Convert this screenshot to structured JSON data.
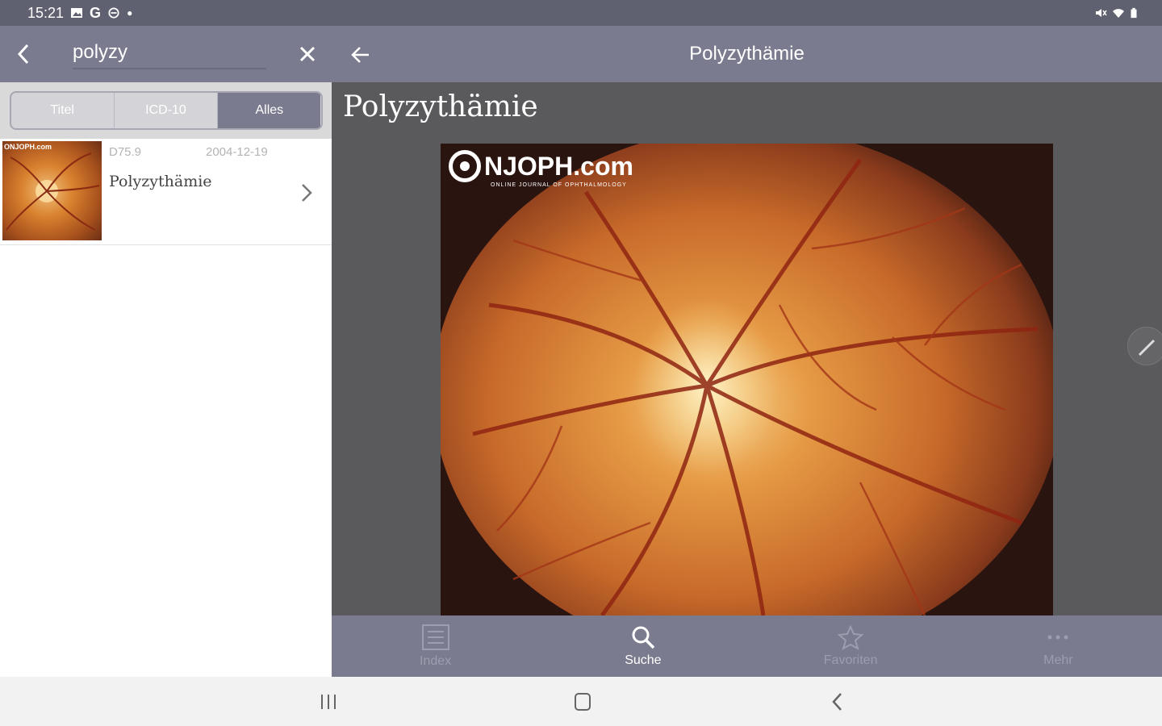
{
  "status_bar": {
    "time": "15:21",
    "notifications": [
      "image-icon",
      "google-icon",
      "minus-circle-icon",
      "dot-icon"
    ],
    "system": [
      "mute-icon",
      "wifi-icon",
      "battery-icon"
    ]
  },
  "search": {
    "value": "polyzy",
    "placeholder": ""
  },
  "filter_tabs": [
    {
      "label": "Titel",
      "active": false
    },
    {
      "label": "ICD-10",
      "active": false
    },
    {
      "label": "Alles",
      "active": true
    }
  ],
  "results": [
    {
      "code": "D75.9",
      "date": "2004-12-19",
      "title": "Polyzythämie",
      "thumb_watermark": "ONJOPH.com"
    }
  ],
  "detail": {
    "header_title": "Polyzythämie",
    "content_title": "Polyzythämie",
    "image_logo": "NJOPH.com",
    "image_logo_sub": "ONLINE JOURNAL OF OPHTHALMOLOGY"
  },
  "bottom_tabs": [
    {
      "label": "Index",
      "icon": "list-icon",
      "active": false
    },
    {
      "label": "Suche",
      "icon": "search-icon",
      "active": true
    },
    {
      "label": "Favoriten",
      "icon": "star-icon",
      "active": false
    },
    {
      "label": "Mehr",
      "icon": "more-icon",
      "active": false
    }
  ],
  "colors": {
    "primary": "#7a7b8e",
    "status_bar": "#5f6070",
    "content_bg": "#5a5a5c"
  }
}
